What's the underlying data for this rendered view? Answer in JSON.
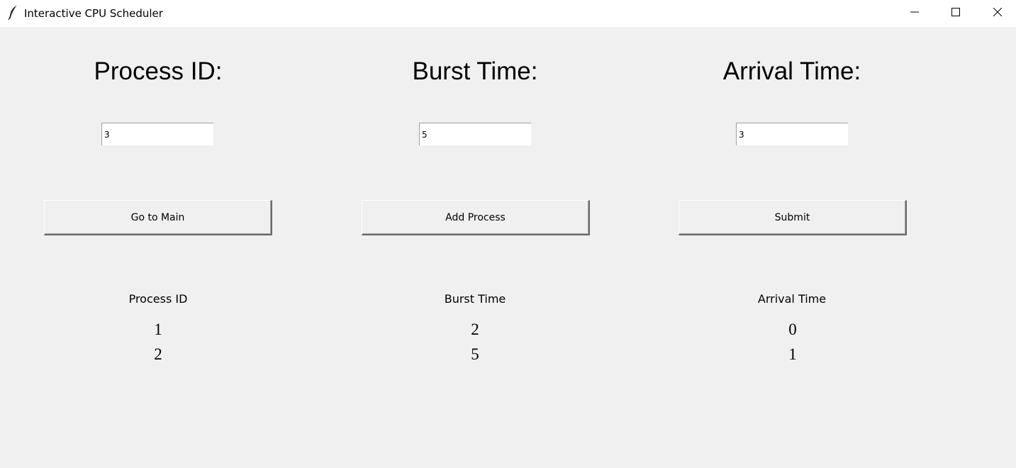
{
  "window": {
    "title": "Interactive CPU Scheduler",
    "icons": {
      "app": "feather-icon",
      "minimize": "minimize-icon",
      "maximize": "maximize-icon",
      "close": "close-icon"
    }
  },
  "form": {
    "process_id_label": "Process ID:",
    "burst_time_label": "Burst Time:",
    "arrival_time_label": "Arrival Time:",
    "process_id_value": "3",
    "burst_time_value": "5",
    "arrival_time_value": "3"
  },
  "buttons": {
    "go_to_main": "Go to Main",
    "add_process": "Add Process",
    "submit": "Submit"
  },
  "table": {
    "headers": [
      "Process ID",
      "Burst Time",
      "Arrival Time"
    ],
    "rows": [
      [
        "1",
        "2",
        "0"
      ],
      [
        "2",
        "5",
        "1"
      ]
    ]
  }
}
